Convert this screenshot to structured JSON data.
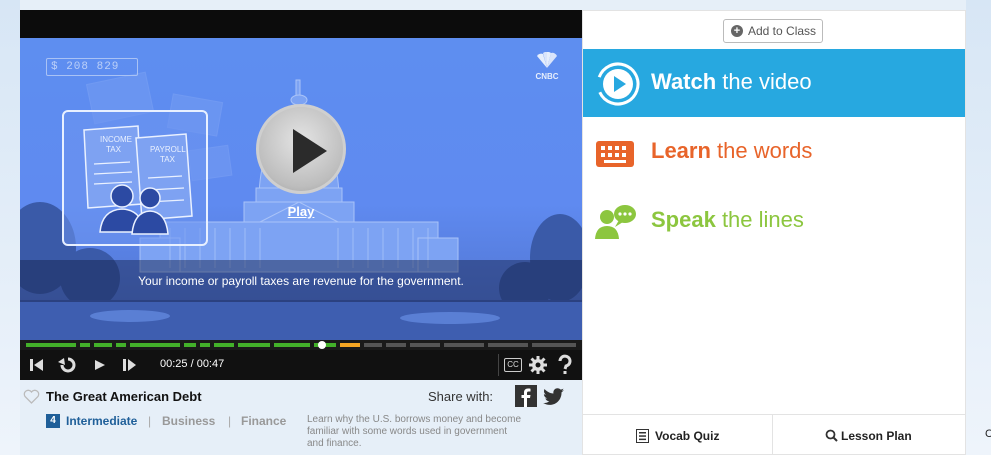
{
  "video": {
    "counter": "$ 208 829",
    "brand": "CNBC",
    "play_label": "Play",
    "caption": "Your income or payroll taxes are revenue for the government.",
    "card_texts": {
      "income_tax": "INCOME TAX",
      "payroll_tax": "PAYROLL TAX"
    },
    "time": "00:25 / 00:47",
    "cc_label": "CC",
    "progress_fraction": 0.53
  },
  "info": {
    "title": "The Great American Debt",
    "share_label": "Share with:",
    "level_number": "4",
    "level_name": "Intermediate",
    "separator": "|",
    "categories": [
      "Business",
      "Finance"
    ],
    "description": "Learn why the U.S. borrows money and become familiar with some words used in government and finance."
  },
  "panel": {
    "add_to_class": "Add to Class",
    "items": [
      {
        "bold": "Watch",
        "rest": " the video"
      },
      {
        "bold": "Learn",
        "rest": " the words"
      },
      {
        "bold": "Speak",
        "rest": " the lines"
      }
    ],
    "vocab_quiz": "Vocab Quiz",
    "lesson_plan": "Lesson Plan"
  },
  "edge_glyph": "C",
  "colors": {
    "watch_active_bg": "#27a8e0",
    "learn": "#e8642a",
    "speak": "#8cc63f",
    "progress_played": "#43b02a",
    "progress_buffer": "#f5a623",
    "link_blue": "#1f5f99"
  }
}
